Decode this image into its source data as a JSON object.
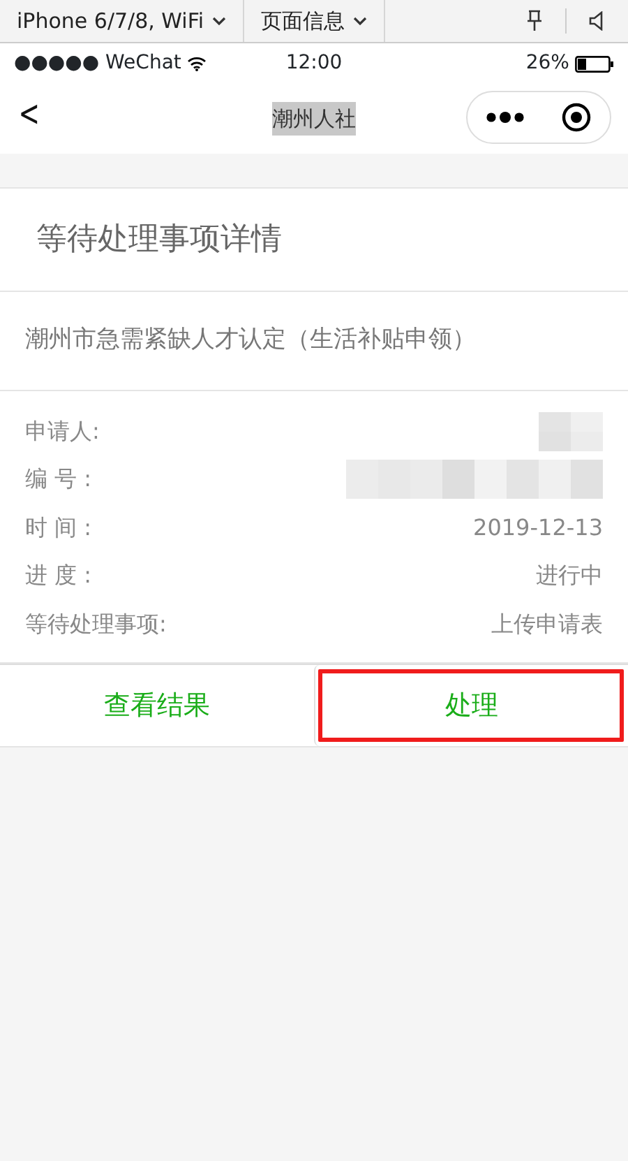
{
  "devtools_bar": {
    "device": "iPhone 6/7/8, WiFi",
    "page_info": "页面信息"
  },
  "status_bar": {
    "carrier": "●●●●● WeChat",
    "time": "12:00",
    "battery": "26%"
  },
  "nav_bar": {
    "back": "<",
    "title": "潮州人社",
    "title_selected": true
  },
  "card": {
    "heading": "等待处理事项详情",
    "item_name": "潮州市急需紧缺人才认定（生活补贴申领）",
    "details": [
      {
        "label": "申请人:",
        "kind": "redacted"
      },
      {
        "label": "编 号 :",
        "kind": "redacted"
      },
      {
        "label": "时 间 :",
        "kind": "text",
        "value": "2019-12-13"
      },
      {
        "label": "进 度 :",
        "kind": "text",
        "value": "进行中"
      },
      {
        "label": "等待处理事项:",
        "kind": "text",
        "value": "上传申请表"
      }
    ]
  },
  "actions": [
    {
      "label": "查看结果",
      "highlighted": false
    },
    {
      "label": "处理",
      "highlighted": true
    }
  ]
}
